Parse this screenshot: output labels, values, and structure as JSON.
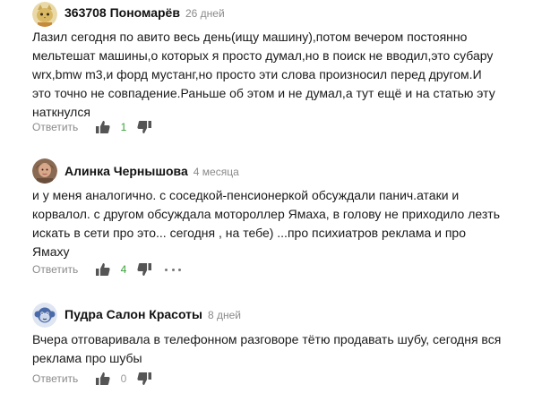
{
  "comments": [
    {
      "author": "363708 Пономарёв",
      "time": "26 дней",
      "avatar": "cat-avatar",
      "lines": [
        "Лазил сегодня по авито весь день(ищу машину),потом вечером постоянно",
        "мельтешат машины,о которых я просто думал,но в поиск не вводил,это субару",
        "wrx,bmw m3,и форд мустанг,но просто эти слова произносил перед другом.И",
        "это точно не совпадение.Раньше об этом и не думал,а тут ещё и на статью эту",
        "наткнулся"
      ],
      "reply_label": "Ответить",
      "likes": "1",
      "likes_color": "#3aa13a"
    },
    {
      "author": "Алинка Чернышова",
      "time": "4 месяца",
      "avatar": "photo-avatar",
      "lines": [
        "и у меня аналогично. с соседкой-пенсионеркой обсуждали панич.атаки и",
        "корвалол. с другом обсуждала мотороллер Ямаха, в голову не приходило лезть",
        "искать в сети про это... сегодня , на тебе) ...про психиатров реклама и про",
        "Ямаху"
      ],
      "reply_label": "Ответить",
      "likes": "4",
      "likes_color": "#3aa13a"
    },
    {
      "author": "Пудра Салон Красоты",
      "time": "8 дней",
      "avatar": "monkey-avatar",
      "lines": [
        "Вчера отговаривала в телефонном разговоре тётю продавать шубу, сегодня вся",
        "реклама про шубы"
      ],
      "reply_label": "Ответить",
      "likes": "0",
      "likes_color": "#9a9a9a"
    }
  ]
}
